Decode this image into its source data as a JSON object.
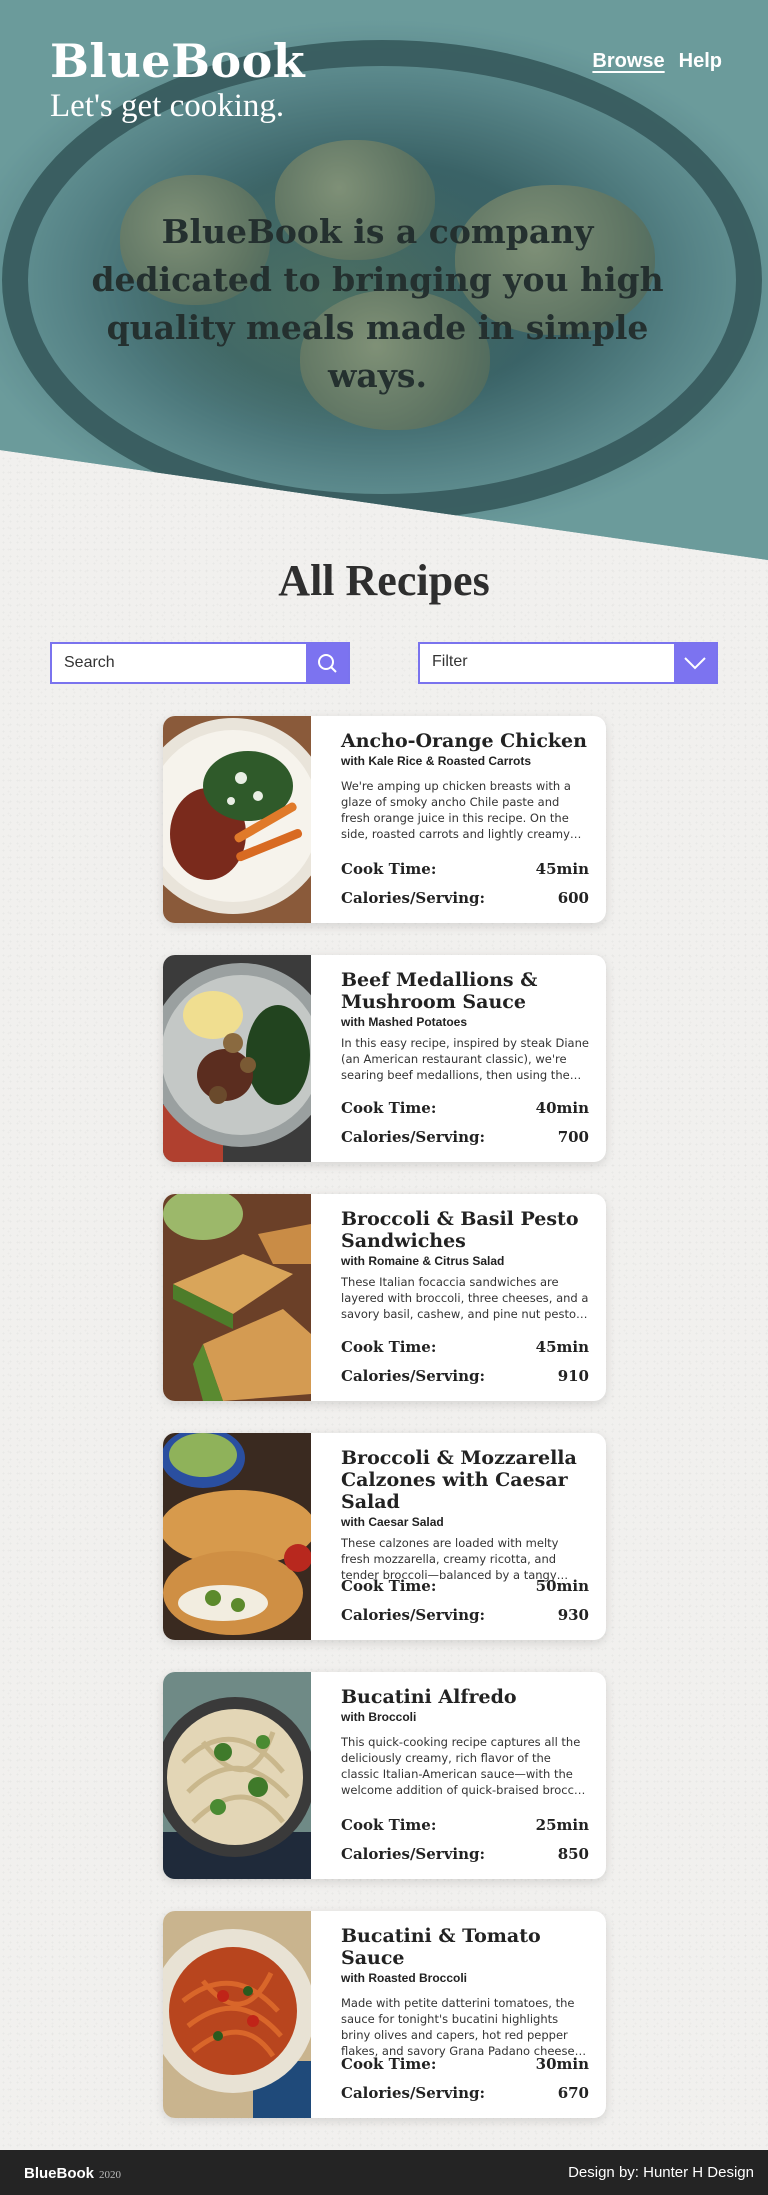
{
  "header": {
    "brand": "BlueBook",
    "tagline": "Let's get cooking.",
    "nav": [
      {
        "label": "Browse",
        "active": true
      },
      {
        "label": "Help",
        "active": false
      }
    ],
    "mission": "BlueBook is a company dedicated to bringing you high quality meals made in simple ways."
  },
  "recipes_section": {
    "title": "All Recipes",
    "search_placeholder": "Search",
    "search_icon": "search-icon",
    "filter_label": "Filter",
    "filter_icon": "chevron-down-icon",
    "cook_time_label": "Cook Time:",
    "calories_label": "Calories/Serving:"
  },
  "recipes": [
    {
      "title": "Ancho-Orange Chicken",
      "subtitle": "with Kale Rice & Roasted Carrots",
      "description": "We're amping up chicken breasts with a glaze of smoky ancho Chile paste and fresh orange juice in this recipe. On the side, roasted carrots and lightly creamy kale rice round out the plate.",
      "cook_time": "45min",
      "calories": "600"
    },
    {
      "title": "Beef Medallions & Mushroom Sauce",
      "subtitle": "with Mashed Potatoes",
      "description": "In this easy recipe, inspired by steak Diane (an American restaurant classic), we're searing beef medallions, then using the fond to build a rich mushroom sauce.",
      "cook_time": "40min",
      "calories": "700"
    },
    {
      "title": "Broccoli & Basil Pesto Sandwiches",
      "subtitle": "with Romaine & Citrus Salad",
      "description": "These Italian focaccia sandwiches are layered with broccoli, three cheeses, and a savory basil, cashew, and pine nut pesto spread.",
      "cook_time": "45min",
      "calories": "910"
    },
    {
      "title": "Broccoli & Mozzarella Calzones with Caesar Salad",
      "subtitle": "with Caesar Salad",
      "description": "These calzones are loaded with melty fresh mozzarella, creamy ricotta, and tender broccoli—balanced by a tangy tomato sauce for dipping.",
      "cook_time": "50min",
      "calories": "930"
    },
    {
      "title": "Bucatini Alfredo",
      "subtitle": "with Broccoli",
      "description": "This quick-cooking recipe captures all the deliciously creamy, rich flavor of the classic Italian-American sauce—with the welcome addition of quick-braised broccoli florets.",
      "cook_time": "25min",
      "calories": "850"
    },
    {
      "title": "Bucatini & Tomato Sauce",
      "subtitle": "with Roasted Broccoli",
      "description": "Made with petite datterini tomatoes, the sauce for tonight's bucatini highlights briny olives and capers, hot red pepper flakes, and savory Grana Padano cheese for a bold bite.",
      "cook_time": "30min",
      "calories": "670"
    }
  ],
  "footer": {
    "brand": "BlueBook",
    "year": "2020",
    "credit": "Design by: Hunter H Design"
  }
}
